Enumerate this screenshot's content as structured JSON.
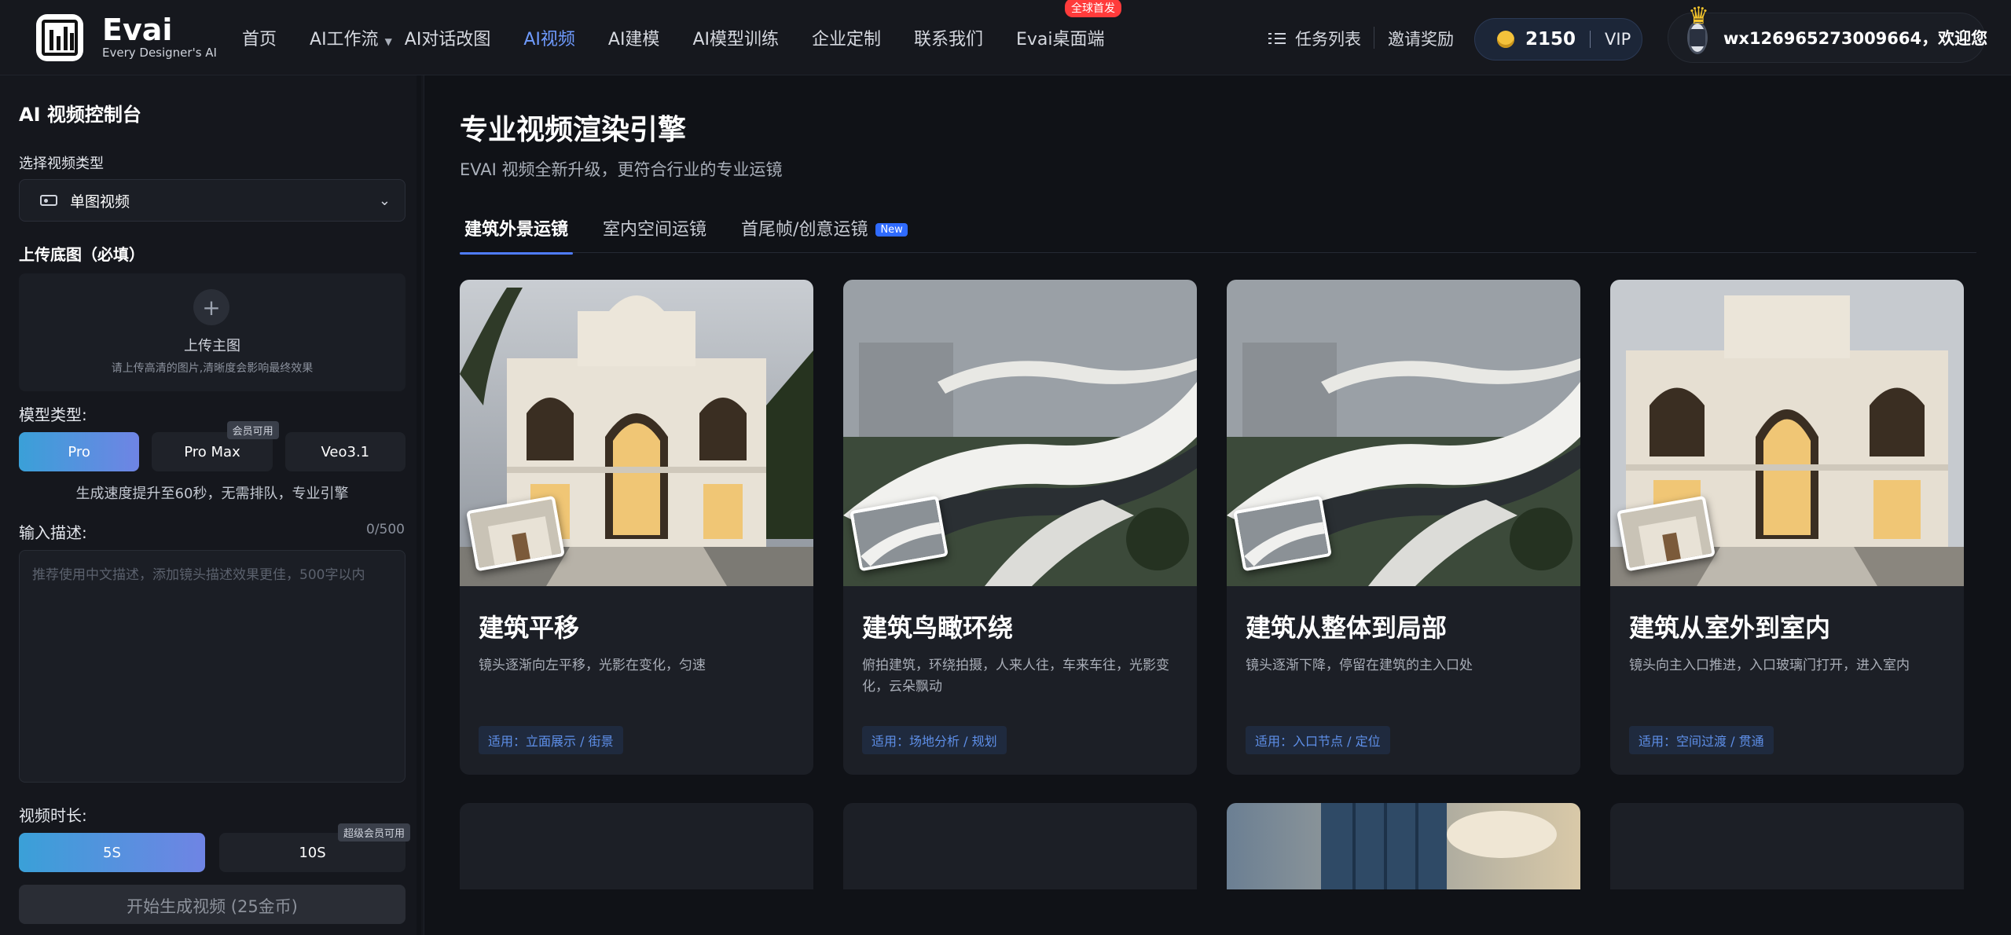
{
  "brand": {
    "name": "Evai",
    "tagline": "Every Designer's AI"
  },
  "nav": {
    "items": [
      {
        "label": "首页"
      },
      {
        "label": "AI工作流"
      },
      {
        "label": "AI对话改图"
      },
      {
        "label": "AI视频"
      },
      {
        "label": "AI建模"
      },
      {
        "label": "AI模型训练"
      },
      {
        "label": "企业定制"
      },
      {
        "label": "联系我们"
      },
      {
        "label": "Evai桌面端"
      }
    ],
    "active_index": 3,
    "desktop_badge": "全球首发"
  },
  "header": {
    "task_list": "任务列表",
    "invite": "邀请奖励",
    "coins": "2150",
    "vip": "VIP",
    "user_greeting": "wx126965273009664，欢迎您"
  },
  "sidebar": {
    "title": "AI 视频控制台",
    "video_type_label": "选择视频类型",
    "video_type_value": "单图视频",
    "upload_heading": "上传底图（必填）",
    "upload_main": "上传主图",
    "upload_hint": "请上传高清的图片,清晰度会影响最终效果",
    "model_label": "模型类型:",
    "models": [
      {
        "label": "Pro"
      },
      {
        "label": "Pro Max",
        "badge": "会员可用"
      },
      {
        "label": "Veo3.1"
      }
    ],
    "speed_note": "生成速度提升至60秒，无需排队，专业引擎",
    "desc_label": "输入描述:",
    "desc_count": "0/500",
    "desc_placeholder": "推荐使用中文描述，添加镜头描述效果更佳，500字以内",
    "duration_label": "视频时长:",
    "durations": [
      {
        "label": "5S"
      },
      {
        "label": "10S",
        "badge": "超级会员可用"
      }
    ],
    "generate_button": "开始生成视频 (25金币)"
  },
  "main": {
    "title": "专业视频渲染引擎",
    "subtitle": "EVAI 视频全新升级，更符合行业的专业运镜",
    "tabs": [
      {
        "label": "建筑外景运镜"
      },
      {
        "label": "室内空间运镜"
      },
      {
        "label": "首尾帧/创意运镜",
        "badge": "New"
      }
    ],
    "cards": [
      {
        "title": "建筑平移",
        "desc": "镜头逐渐向左平移，光影在变化，匀速",
        "tag": "适用：立面展示 / 街景"
      },
      {
        "title": "建筑鸟瞰环绕",
        "desc": "俯拍建筑，环绕拍摄，人来人往，车来车往，光影变化，云朵飘动",
        "tag": "适用：场地分析 / 规划"
      },
      {
        "title": "建筑从整体到局部",
        "desc": "镜头逐渐下降，停留在建筑的主入口处",
        "tag": "适用：入口节点 / 定位"
      },
      {
        "title": "建筑从室外到室内",
        "desc": "镜头向主入口推进，入口玻璃门打开，进入室内",
        "tag": "适用：空间过渡 / 贯通"
      }
    ]
  },
  "colors": {
    "accent": "#6f9bff",
    "gradient_start": "#3aa0d8",
    "gradient_end": "#6f84e4",
    "badge_red": "#ff3b3b",
    "tag_text": "#5e8fe8"
  }
}
